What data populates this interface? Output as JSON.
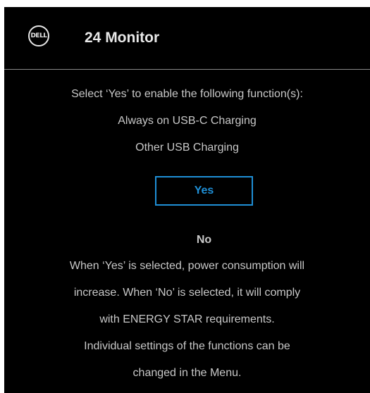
{
  "header": {
    "logo_text": "DELL",
    "title": "24 Monitor"
  },
  "prompt": {
    "intro": "Select ‘Yes’ to enable the following function(s):",
    "functions": [
      "Always on USB-C Charging",
      "Other USB Charging"
    ]
  },
  "buttons": {
    "yes_label": "Yes",
    "no_label": "No"
  },
  "notes": [
    "When ‘Yes’ is selected, power consumption will",
    "increase. When ‘No’ is selected, it will comply",
    "with ENERGY STAR requirements.",
    "Individual settings of the functions can be",
    "changed in the Menu."
  ],
  "colors": {
    "background": "#000000",
    "accent": "#1f8fd6",
    "text": "#c8c8c8"
  }
}
